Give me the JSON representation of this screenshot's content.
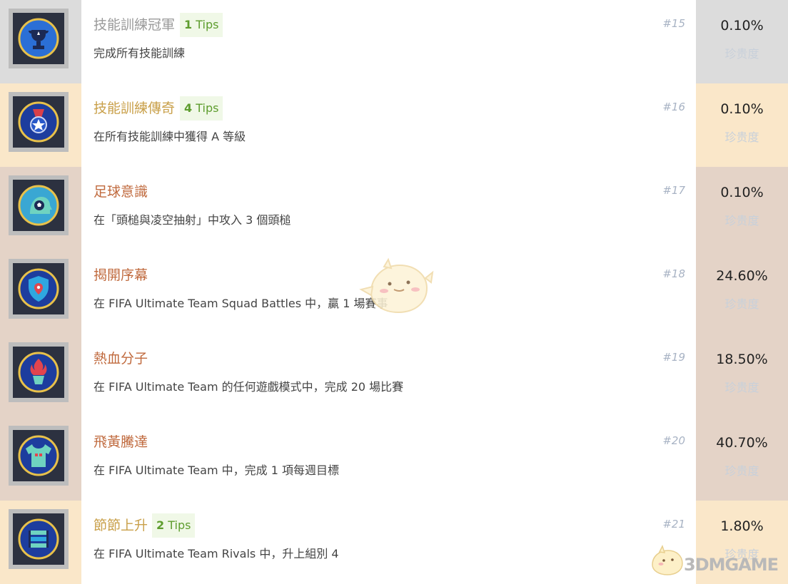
{
  "achievements": [
    {
      "title": "技能訓練冠軍",
      "tips": {
        "count": "1",
        "word": "Tips"
      },
      "description": "完成所有技能訓練",
      "rank": "#15",
      "percent": "0.10%",
      "rarity_label": "珍贵度",
      "title_color": "#9a9a9a",
      "band_color": "#dcdcdc",
      "icon": "trophy-icon"
    },
    {
      "title": "技能訓練傳奇",
      "tips": {
        "count": "4",
        "word": "Tips"
      },
      "description": "在所有技能訓練中獲得 A 等級",
      "rank": "#16",
      "percent": "0.10%",
      "rarity_label": "珍贵度",
      "title_color": "#c9a04a",
      "band_color": "#fae7c9",
      "icon": "medal-star-icon"
    },
    {
      "title": "足球意識",
      "description": "在「頭槌與凌空抽射」中攻入 3 個頭槌",
      "rank": "#17",
      "percent": "0.10%",
      "rarity_label": "珍贵度",
      "title_color": "#c06a3e",
      "band_color": "#e4d3c7",
      "icon": "head-ball-icon"
    },
    {
      "title": "揭開序幕",
      "description": "在 FIFA Ultimate Team Squad Battles 中，贏 1 場賽事",
      "rank": "#18",
      "percent": "24.60%",
      "rarity_label": "珍贵度",
      "title_color": "#c06a3e",
      "band_color": "#e4d3c7",
      "icon": "shield-icon"
    },
    {
      "title": "熱血分子",
      "description": "在 FIFA Ultimate Team 的任何遊戲模式中，完成 20 場比賽",
      "rank": "#19",
      "percent": "18.50%",
      "rarity_label": "珍贵度",
      "title_color": "#c06a3e",
      "band_color": "#e4d3c7",
      "icon": "torch-icon"
    },
    {
      "title": "飛黃騰達",
      "description": "在 FIFA Ultimate Team 中，完成 1 項每週目標",
      "rank": "#20",
      "percent": "40.70%",
      "rarity_label": "珍贵度",
      "title_color": "#c06a3e",
      "band_color": "#e4d3c7",
      "icon": "jersey-icon"
    },
    {
      "title": "節節上升",
      "tips": {
        "count": "2",
        "word": "Tips"
      },
      "description": "在 FIFA Ultimate Team Rivals 中，升上組別 4",
      "rank": "#21",
      "percent": "1.80%",
      "rarity_label": "珍贵度",
      "title_color": "#c9a04a",
      "band_color": "#fae7c9",
      "icon": "stairs-icon"
    }
  ],
  "watermark": {
    "text": "3DMGAME"
  }
}
